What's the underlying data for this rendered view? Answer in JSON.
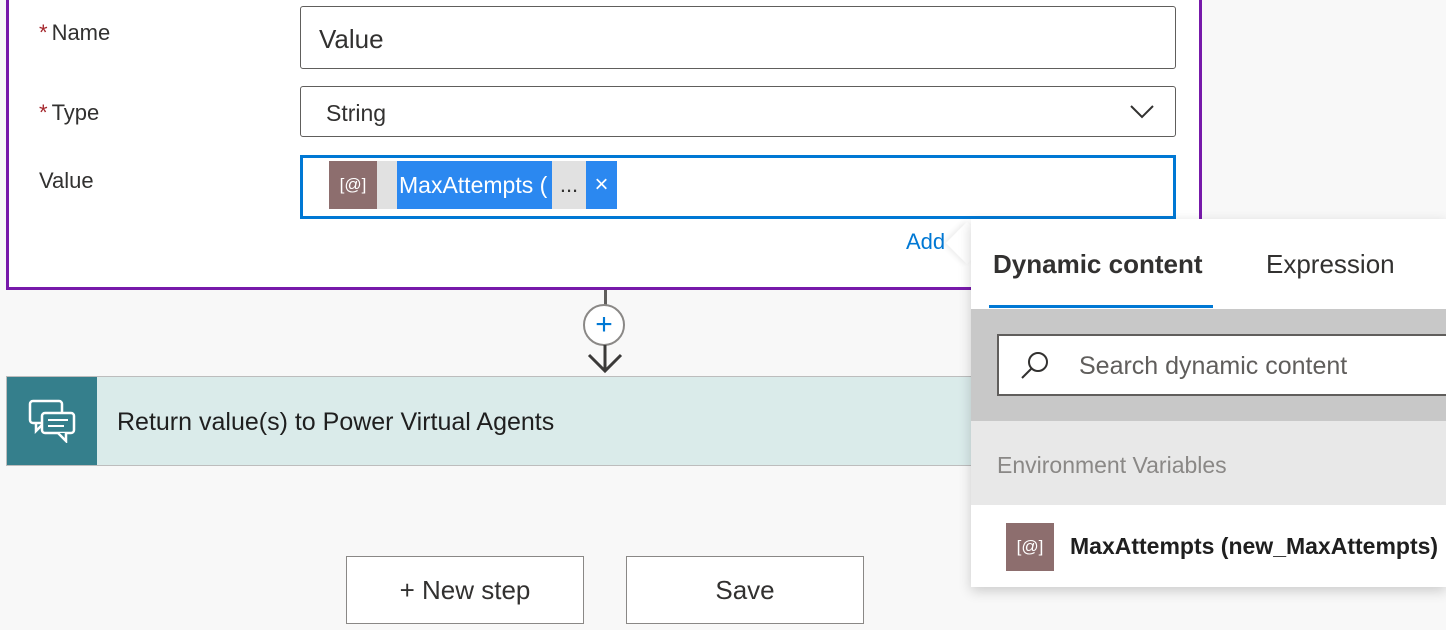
{
  "form": {
    "name_label": "Name",
    "name_required": "*",
    "name_value": "Value",
    "type_label": "Type",
    "type_required": "*",
    "type_value": "String",
    "value_label": "Value",
    "value_token": {
      "icon_text": "[@]",
      "label": "MaxAttempts (",
      "ellipsis": "...",
      "close": "×"
    },
    "add_link": "Add d"
  },
  "connector": {
    "plus": "+"
  },
  "step": {
    "title": "Return value(s) to Power Virtual Agents",
    "icon": "chat-bubbles-icon",
    "color": "#357f8c"
  },
  "buttons": {
    "new_step": "+ New step",
    "save": "Save"
  },
  "flyout": {
    "tabs": [
      "Dynamic content",
      "Expression"
    ],
    "active_tab": "Dynamic content",
    "search_placeholder": "Search dynamic content",
    "section_title": "Environment Variables",
    "items": [
      {
        "icon_text": "[@]",
        "label": "MaxAttempts (new_MaxAttempts)"
      }
    ]
  },
  "colors": {
    "card_border": "#7719aa",
    "accent": "#0078d4",
    "token": "#2b88f0",
    "env_icon": "#8d6e6e"
  }
}
